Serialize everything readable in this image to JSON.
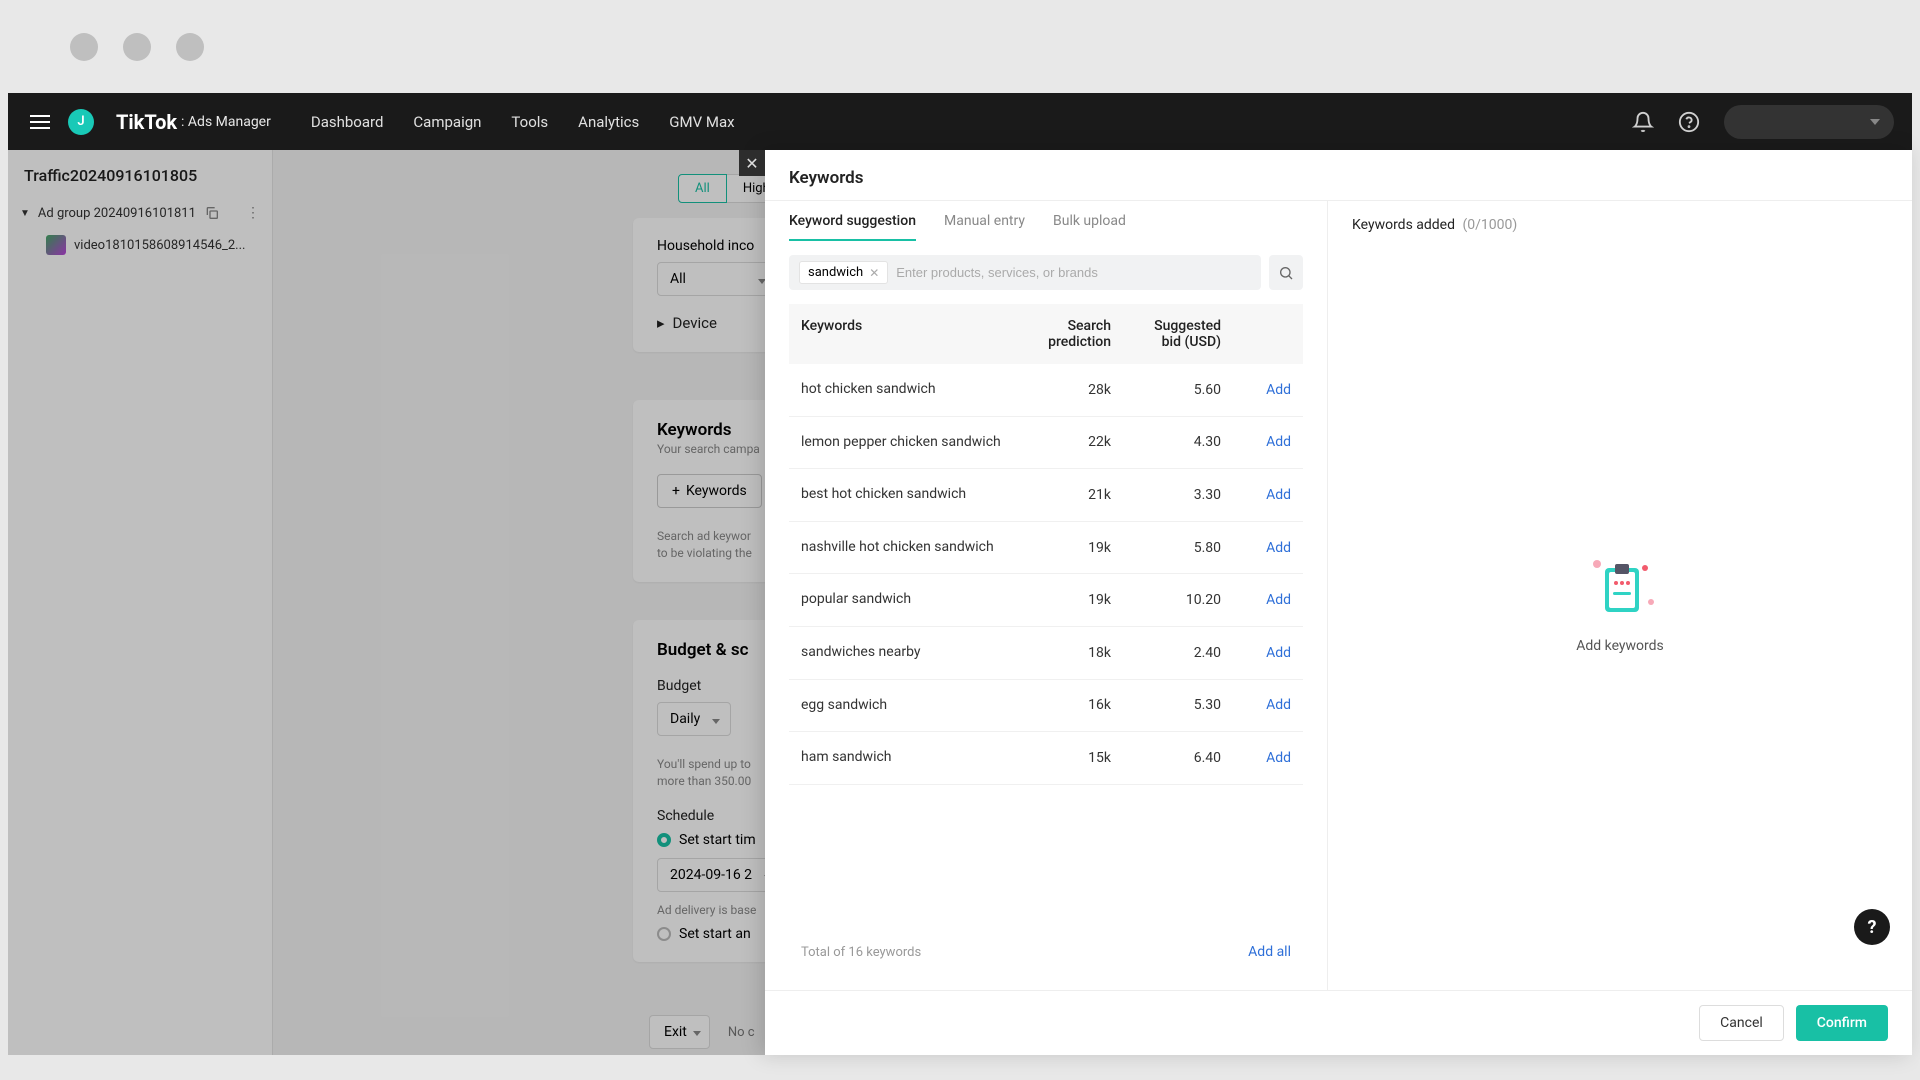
{
  "nav": {
    "brand": "TikTok",
    "brand_sub": ": Ads Manager",
    "avatar_letter": "J",
    "links": [
      "Dashboard",
      "Campaign",
      "Tools",
      "Analytics",
      "GMV Max"
    ]
  },
  "sidebar": {
    "campaign_name": "Traffic20240916101805",
    "adgroup": "Ad group 20240916101811",
    "video": "video1810158608914546_2..."
  },
  "bg": {
    "pill_all": "All",
    "pill_high": "High",
    "household": "Household inco",
    "household_value": "All",
    "device": "Device",
    "keywords_title": "Keywords",
    "keywords_sub": "Your search campa",
    "keywords_btn": "Keywords",
    "keywords_note1": "Search ad keywor",
    "keywords_note2": "to be violating the",
    "budget_title": "Budget & sc",
    "budget_label": "Budget",
    "budget_select": "Daily",
    "budget_note1": "You'll spend up to",
    "budget_note2": "more than 350.00",
    "schedule_label": "Schedule",
    "schedule_opt1": "Set start tim",
    "schedule_date": "2024-09-16 2",
    "schedule_note": "Ad delivery is base",
    "schedule_opt2": "Set start an",
    "exit": "Exit",
    "exit_right": "No c"
  },
  "modal": {
    "title": "Keywords",
    "tabs": {
      "suggestion": "Keyword suggestion",
      "manual": "Manual entry",
      "bulk": "Bulk upload"
    },
    "chip": "sandwich",
    "placeholder": "Enter products, services, or brands",
    "columns": {
      "kw": "Keywords",
      "sp1": "Search",
      "sp2": "prediction",
      "bid1": "Suggested",
      "bid2": "bid (USD)"
    },
    "rows": [
      {
        "kw": "hot chicken sandwich",
        "sp": "28k",
        "bid": "5.60"
      },
      {
        "kw": "lemon pepper chicken sandwich",
        "sp": "22k",
        "bid": "4.30"
      },
      {
        "kw": "best hot chicken sandwich",
        "sp": "21k",
        "bid": "3.30"
      },
      {
        "kw": "nashville hot chicken sandwich",
        "sp": "19k",
        "bid": "5.80"
      },
      {
        "kw": "popular sandwich",
        "sp": "19k",
        "bid": "10.20"
      },
      {
        "kw": "sandwiches nearby",
        "sp": "18k",
        "bid": "2.40"
      },
      {
        "kw": "egg sandwich",
        "sp": "16k",
        "bid": "5.30"
      },
      {
        "kw": "ham sandwich",
        "sp": "15k",
        "bid": "6.40"
      }
    ],
    "add_label": "Add",
    "total": "Total of 16 keywords",
    "add_all": "Add all",
    "right_title": "Keywords added",
    "right_count": "(0/1000)",
    "empty_text": "Add keywords",
    "cancel": "Cancel",
    "confirm": "Confirm"
  }
}
